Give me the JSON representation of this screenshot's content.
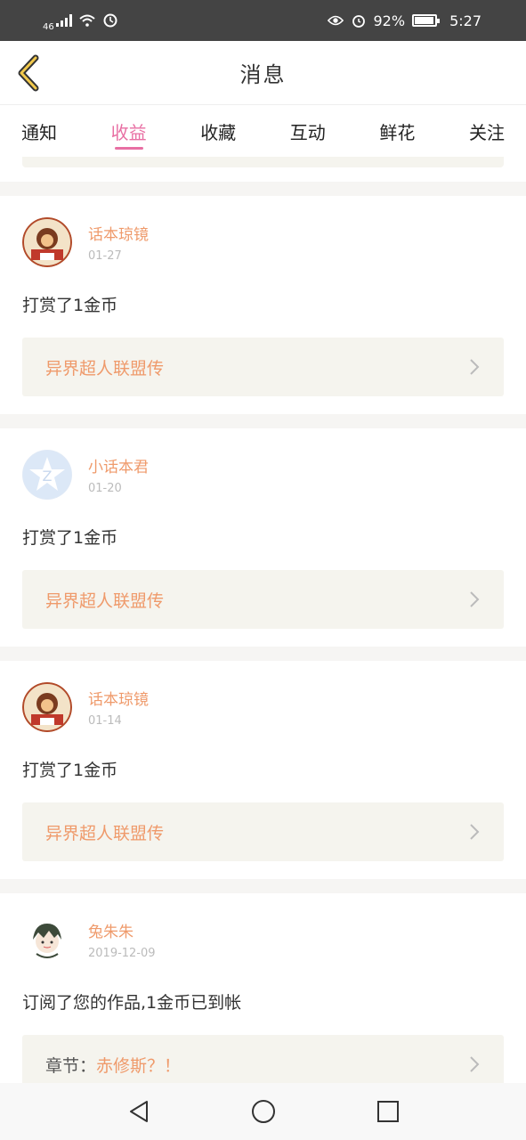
{
  "status_bar": {
    "network": "46",
    "battery": "92%",
    "time": "5:27"
  },
  "header": {
    "title": "消息"
  },
  "tabs": [
    {
      "label": "通知",
      "active": false
    },
    {
      "label": "收益",
      "active": true
    },
    {
      "label": "收藏",
      "active": false
    },
    {
      "label": "互动",
      "active": false
    },
    {
      "label": "鲜花",
      "active": false
    },
    {
      "label": "关注",
      "active": false
    }
  ],
  "messages": [
    {
      "username": "话本琼镜",
      "date": "01-27",
      "text": "打赏了1金币",
      "link_prefix": "",
      "link": "异界超人联盟传"
    },
    {
      "username": "小话本君",
      "date": "01-20",
      "text": "打赏了1金币",
      "link_prefix": "",
      "link": "异界超人联盟传"
    },
    {
      "username": "话本琼镜",
      "date": "01-14",
      "text": "打赏了1金币",
      "link_prefix": "",
      "link": "异界超人联盟传"
    },
    {
      "username": "兔朱朱",
      "date": "2019-12-09",
      "text": "订阅了您的作品,1金币已到帐",
      "link_prefix": "章节：",
      "link": "赤修斯？！"
    }
  ],
  "colors": {
    "accent": "#e86fa3",
    "username": "#ef9a6b",
    "status_bar": "#444444"
  }
}
